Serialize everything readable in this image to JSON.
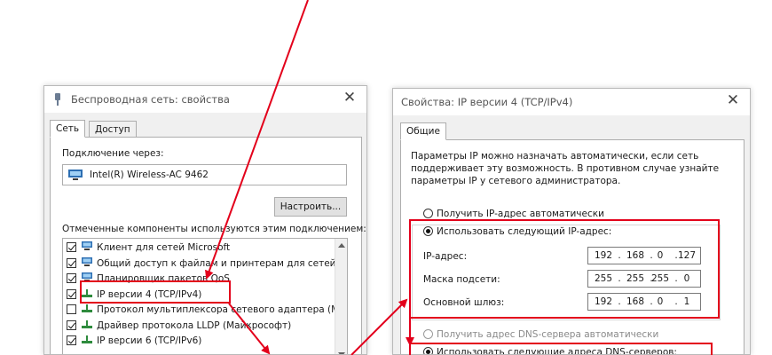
{
  "left_dialog": {
    "title": "Беспроводная сеть: свойства",
    "close_glyph": "✕",
    "tabs": [
      {
        "label": "Сеть"
      },
      {
        "label": "Доступ"
      }
    ],
    "connect_via_label": "Подключение через:",
    "adapter_name": "Intel(R) Wireless-AC 9462",
    "configure_button": "Настроить...",
    "components_label": "Отмеченные компоненты используются этим подключением:",
    "components": [
      {
        "label": "Клиент для сетей Microsoft",
        "checked": true,
        "icon": "network-client-icon"
      },
      {
        "label": "Общий доступ к файлам и принтерам для сетей Mi",
        "checked": true,
        "icon": "file-sharing-icon"
      },
      {
        "label": "Планировщик пакетов QoS",
        "checked": true,
        "icon": "qos-icon"
      },
      {
        "label": "IP версии 4 (TCP/IPv4)",
        "checked": true,
        "icon": "protocol-icon"
      },
      {
        "label": "Протокол мультиплексора сетевого адаптера (Май",
        "checked": false,
        "icon": "protocol-icon"
      },
      {
        "label": "Драйвер протокола LLDP (Майкрософт)",
        "checked": true,
        "icon": "protocol-icon"
      },
      {
        "label": "IP версии 6 (TCP/IPv6)",
        "checked": true,
        "icon": "protocol-icon"
      }
    ]
  },
  "right_dialog": {
    "title": "Свойства: IP версии 4 (TCP/IPv4)",
    "close_glyph": "✕",
    "tab_general": "Общие",
    "description": [
      "Параметры IP можно назначать автоматически, если сеть",
      "поддерживает эту возможность. В противном случае узнайте",
      "параметры IP у сетевого администратора."
    ],
    "radio_auto_ip": "Получить IP-адрес автоматически",
    "radio_manual_ip": "Использовать следующий IP-адрес:",
    "fields": [
      {
        "label": "IP-адрес:",
        "octets": [
          "192",
          "168",
          "0",
          "127"
        ]
      },
      {
        "label": "Маска подсети:",
        "octets": [
          "255",
          "255",
          "255",
          "0"
        ]
      },
      {
        "label": "Основной шлюз:",
        "octets": [
          "192",
          "168",
          "0",
          "1"
        ]
      }
    ],
    "radio_auto_dns": "Получить адрес DNS-сервера автоматически",
    "radio_manual_dns": "Использовать следующие адреса DNS-серверов:"
  },
  "annotation_color": "#e3001b"
}
